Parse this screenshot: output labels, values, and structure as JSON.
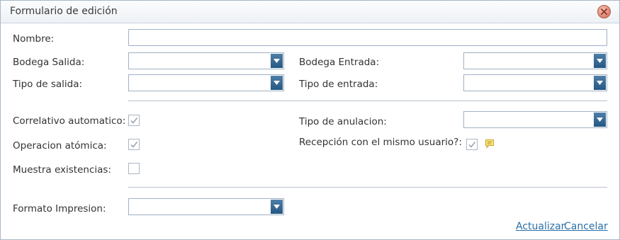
{
  "window": {
    "title": "Formulario de edición",
    "close_icon": "close-icon"
  },
  "fields": {
    "nombre": {
      "label": "Nombre:",
      "value": ""
    },
    "bodega_salida": {
      "label": "Bodega Salida:",
      "value": ""
    },
    "bodega_entrada": {
      "label": "Bodega Entrada:",
      "value": ""
    },
    "tipo_salida": {
      "label": "Tipo de salida:",
      "value": ""
    },
    "tipo_entrada": {
      "label": "Tipo de entrada:",
      "value": ""
    },
    "correlativo": {
      "label": "Correlativo automatico:",
      "checked": true
    },
    "tipo_anulacion": {
      "label": "Tipo de anulacion:",
      "value": ""
    },
    "operacion": {
      "label": "Operacion atómica:",
      "checked": true
    },
    "recepcion": {
      "label": "Recepción con el mismo usuario?:",
      "checked": true,
      "help_icon": "comment-icon"
    },
    "existencias": {
      "label": "Muestra existencias:",
      "checked": false
    },
    "formato": {
      "label": "Formato Impresion:",
      "value": ""
    }
  },
  "actions": {
    "actualizar": "Actualizar",
    "cancelar": "Cancelar"
  },
  "colors": {
    "accent": "#2a6fa6",
    "dropdown_button": "#2f6590",
    "border": "#9fb1c4"
  }
}
